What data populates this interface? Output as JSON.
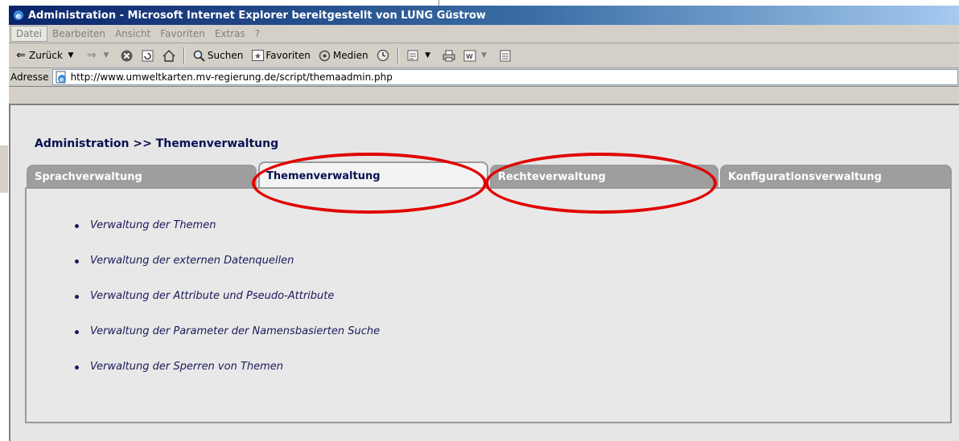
{
  "window": {
    "title": "Administration - Microsoft Internet Explorer bereitgestellt von LUNG Güstrow"
  },
  "menu": [
    "Datei",
    "Bearbeiten",
    "Ansicht",
    "Favoriten",
    "Extras",
    "?"
  ],
  "toolbar": {
    "back_label": "Zurück",
    "search_label": "Suchen",
    "favorites_label": "Favoriten",
    "media_label": "Medien"
  },
  "address": {
    "label": "Adresse",
    "url": "http://www.umweltkarten.mv-regierung.de/script/themaadmin.php"
  },
  "page": {
    "breadcrumb": "Administration >> Themenverwaltung",
    "tabs": [
      {
        "label": "Sprachverwaltung",
        "active": false
      },
      {
        "label": "Themenverwaltung",
        "active": true
      },
      {
        "label": "Rechteverwaltung",
        "active": false
      },
      {
        "label": "Konfigurationsverwaltung",
        "active": false
      }
    ],
    "items": [
      "Verwaltung der Themen",
      "Verwaltung der externen Datenquellen",
      "Verwaltung der Attribute und Pseudo-Attribute",
      "Verwaltung der Parameter der Namensbasierten Suche",
      "Verwaltung der Sperren von Themen"
    ]
  },
  "colors": {
    "highlight_circle": "#e00000",
    "link_text": "#1a1a5a",
    "inactive_tab": "#9e9e9e"
  }
}
